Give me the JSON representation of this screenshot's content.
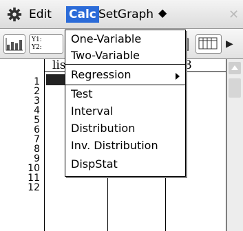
{
  "menubar": {
    "gear_icon": "gear-icon",
    "edit": "Edit",
    "calc": "Calc",
    "setgraph": "SetGraph",
    "diamond": "◆",
    "close": "✕"
  },
  "toolbar": {
    "y_label_1": "Y1:",
    "y_label_2": "Y2:"
  },
  "sheet": {
    "col1_header": "lis",
    "col3_header": "3",
    "rows": [
      "1",
      "2",
      "3",
      "4",
      "5",
      "6",
      "7",
      "8",
      "9",
      "10",
      "11",
      "12"
    ]
  },
  "calc_menu": {
    "items": [
      {
        "label": "One-Variable"
      },
      {
        "label": "Two-Variable"
      },
      {
        "label": "Regression",
        "submenu": true
      },
      {
        "label": "Test"
      },
      {
        "label": "Interval"
      },
      {
        "label": "Distribution"
      },
      {
        "label": "Inv. Distribution"
      },
      {
        "label": "DispStat"
      }
    ]
  },
  "colors": {
    "menu_highlight": "#2b6bd8"
  }
}
